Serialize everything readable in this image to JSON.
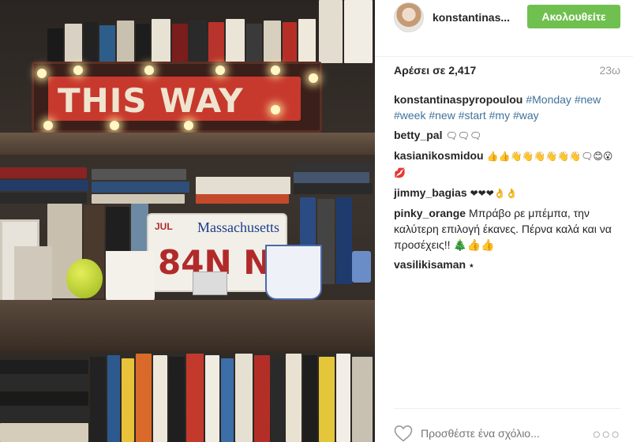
{
  "post": {
    "photo_sign_text": "THIS WAY",
    "photo_plate_state": "Massachusetts",
    "photo_plate_number": "84N N",
    "photo_plate_month": "JUL",
    "header": {
      "username": "konstantinas...",
      "follow_label": "Ακολουθείτε"
    },
    "likes_label": "Αρέσει σε 2,417",
    "time_ago": "23ω",
    "caption": {
      "user": "konstantinaspyropoulou",
      "tags": [
        "#Monday",
        "#new",
        "#week",
        "#new",
        "#start",
        "#my",
        "#way"
      ]
    },
    "comments": [
      {
        "user": "betty_pal",
        "text": "🗨🗨🗨"
      },
      {
        "user": "kasianikosmidou",
        "text": "👍👍👋👋👋👋👋👋🗨😊😮 💋"
      },
      {
        "user": "jimmy_bagias",
        "text": "❤❤❤👌👌"
      },
      {
        "user": "pinky_orange",
        "text": "Μπράβο ρε μπέμπα, την καλύτερη επιλογή έκανες. Πέρνα καλά και να προσέχεις!! 🎄👍👍"
      },
      {
        "user": "vasilikisaman",
        "text": "⭑"
      }
    ],
    "footer": {
      "comment_placeholder": "Προσθέστε ένα σχόλιο...",
      "more_label": "○○○"
    },
    "colors": {
      "follow_bg": "#70c050",
      "hashtag": "#3f729b"
    }
  }
}
